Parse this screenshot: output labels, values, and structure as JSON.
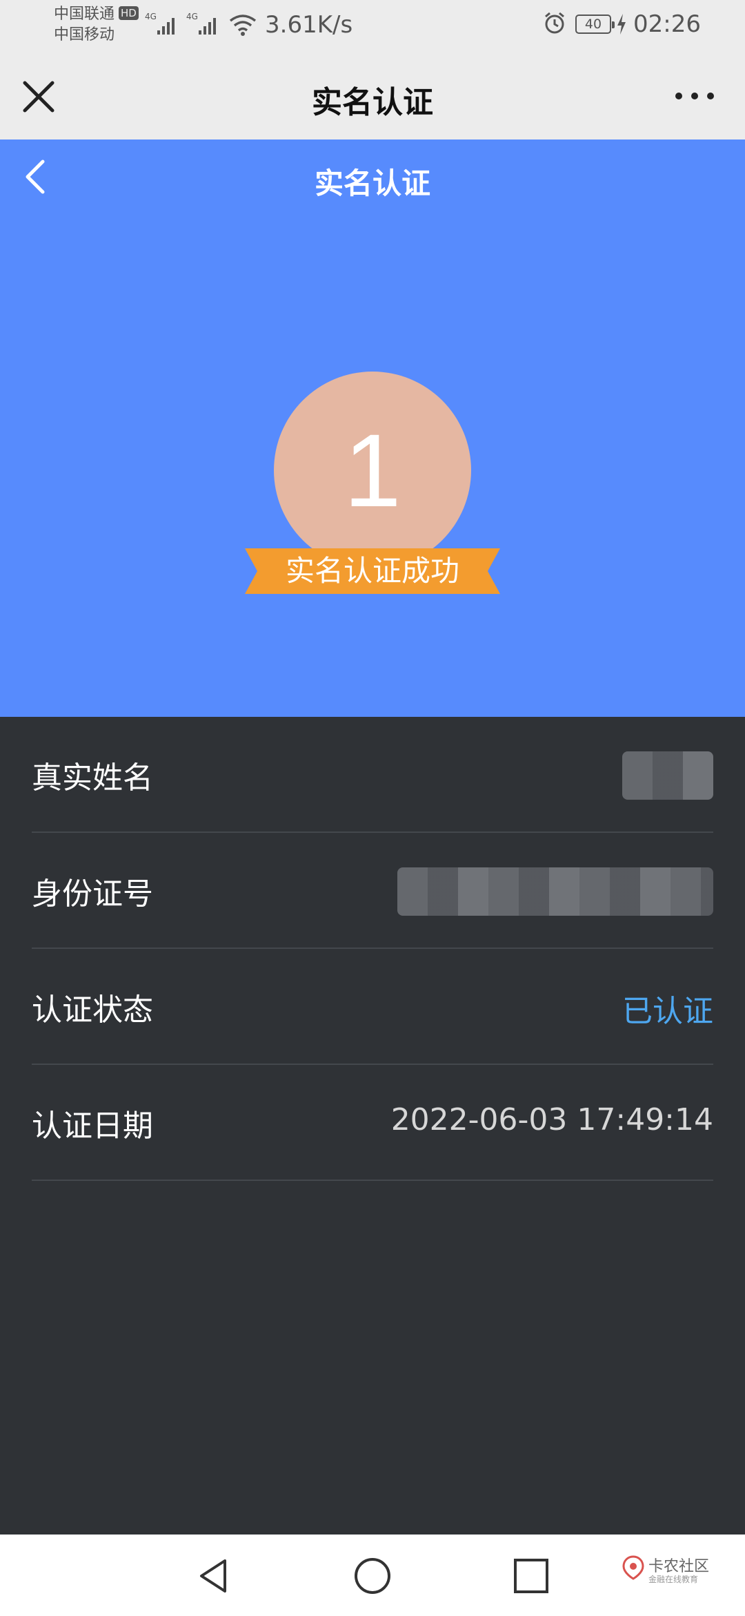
{
  "status_bar": {
    "carrier1": "中国联通",
    "hd": "HD",
    "carrier2": "中国移动",
    "net1": "4G",
    "net2": "4G",
    "speed": "3.61K/s",
    "battery": "40",
    "time": "02:26"
  },
  "wechat_header": {
    "title": "实名认证"
  },
  "hero": {
    "title": "实名认证",
    "avatar_text": "1",
    "badge": "实名认证成功",
    "colors": {
      "background": "#578bfd",
      "avatar": "#e5b7a2",
      "ribbon": "#f39c2f"
    }
  },
  "info": {
    "rows": [
      {
        "label": "真实姓名",
        "value": ""
      },
      {
        "label": "身份证号",
        "value": ""
      },
      {
        "label": "认证状态",
        "value": "已认证"
      },
      {
        "label": "认证日期",
        "value": "2022-06-03 17:49:14"
      }
    ]
  },
  "watermark": {
    "main": "卡农社区",
    "sub": "金融在线教育"
  },
  "icons": [
    "close-icon",
    "more-icon",
    "back-chevron-icon",
    "alarm-icon",
    "wifi-icon",
    "nav-back-icon",
    "nav-home-icon",
    "nav-recents-icon"
  ]
}
